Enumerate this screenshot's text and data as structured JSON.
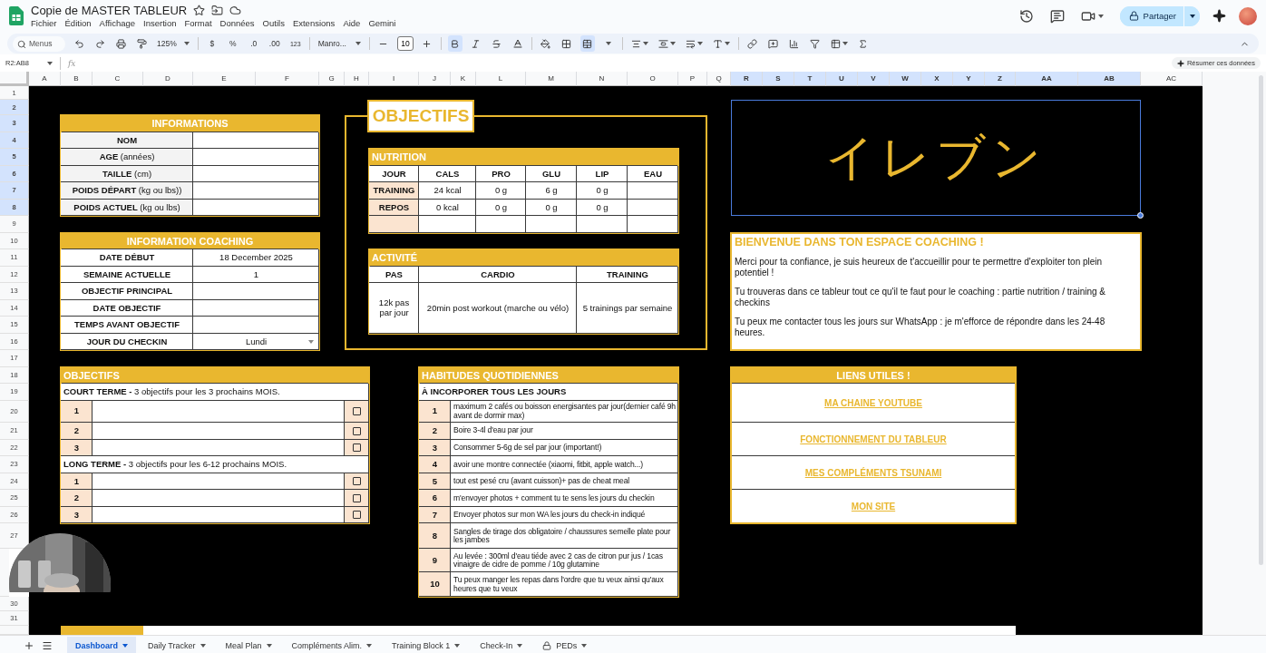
{
  "document": {
    "title": "Copie de MASTER TABLEUR"
  },
  "menu": [
    "Fichier",
    "Édition",
    "Affichage",
    "Insertion",
    "Format",
    "Données",
    "Outils",
    "Extensions",
    "Aide",
    "Gemini"
  ],
  "share_button": "Partager",
  "toolbar": {
    "search_placeholder": "Menus",
    "zoom": "125%",
    "currency": "$",
    "percent": "%",
    "decimals_less": ".0",
    "decimals_more": ".00",
    "number_format": "123",
    "font": "Manro...",
    "font_size": "10",
    "bold": true,
    "merge_cells": true
  },
  "name_box": "R2:AB8",
  "formula_label": "fx",
  "summarize_button": "Résumer ces données",
  "columns": [
    {
      "label": "A",
      "selected": false
    },
    {
      "label": "B",
      "selected": false
    },
    {
      "label": "C",
      "selected": false
    },
    {
      "label": "D",
      "selected": false
    },
    {
      "label": "E",
      "selected": false
    },
    {
      "label": "F",
      "selected": false
    },
    {
      "label": "G",
      "selected": false
    },
    {
      "label": "H",
      "selected": false
    },
    {
      "label": "I",
      "selected": false
    },
    {
      "label": "J",
      "selected": false
    },
    {
      "label": "K",
      "selected": false
    },
    {
      "label": "L",
      "selected": false
    },
    {
      "label": "M",
      "selected": false
    },
    {
      "label": "N",
      "selected": false
    },
    {
      "label": "O",
      "selected": false
    },
    {
      "label": "P",
      "selected": false
    },
    {
      "label": "Q",
      "selected": false
    },
    {
      "label": "R",
      "selected": true
    },
    {
      "label": "S",
      "selected": true
    },
    {
      "label": "T",
      "selected": true
    },
    {
      "label": "U",
      "selected": true
    },
    {
      "label": "V",
      "selected": true
    },
    {
      "label": "W",
      "selected": true
    },
    {
      "label": "X",
      "selected": true
    },
    {
      "label": "Y",
      "selected": true
    },
    {
      "label": "Z",
      "selected": true
    },
    {
      "label": "AA",
      "selected": true
    },
    {
      "label": "AB",
      "selected": true
    },
    {
      "label": "AC",
      "selected": false
    }
  ],
  "rows": [
    {
      "label": "1",
      "selected": false
    },
    {
      "label": "2",
      "selected": true
    },
    {
      "label": "3",
      "selected": true
    },
    {
      "label": "4",
      "selected": true
    },
    {
      "label": "5",
      "selected": true
    },
    {
      "label": "6",
      "selected": true
    },
    {
      "label": "7",
      "selected": true
    },
    {
      "label": "8",
      "selected": true
    },
    {
      "label": "9",
      "selected": false
    },
    {
      "label": "10",
      "selected": false
    },
    {
      "label": "11",
      "selected": false
    },
    {
      "label": "12",
      "selected": false
    },
    {
      "label": "13",
      "selected": false
    },
    {
      "label": "14",
      "selected": false
    },
    {
      "label": "15",
      "selected": false
    },
    {
      "label": "16",
      "selected": false
    },
    {
      "label": "17",
      "selected": false
    },
    {
      "label": "18",
      "selected": false
    },
    {
      "label": "19",
      "selected": false
    },
    {
      "label": "20",
      "selected": false
    },
    {
      "label": "21",
      "selected": false
    },
    {
      "label": "22",
      "selected": false
    },
    {
      "label": "23",
      "selected": false
    },
    {
      "label": "24",
      "selected": false
    },
    {
      "label": "25",
      "selected": false
    },
    {
      "label": "26",
      "selected": false
    },
    {
      "label": "27",
      "selected": false
    },
    {
      "label": "30",
      "selected": false,
      "after_gap": true
    },
    {
      "label": "31",
      "selected": false
    }
  ],
  "informations": {
    "title": "INFORMATIONS",
    "rows": [
      {
        "label": "NOM"
      },
      {
        "label": "AGE",
        "unit": "(années)"
      },
      {
        "label": "TAILLE",
        "unit": "(cm)"
      },
      {
        "label": "POIDS DÉPART",
        "unit": "(kg ou lbs))"
      },
      {
        "label": "POIDS ACTUEL",
        "unit": "(kg ou lbs)"
      }
    ]
  },
  "coaching": {
    "title": "INFORMATION COACHING",
    "rows": [
      {
        "label": "DATE DÉBUT",
        "kind": "text",
        "value": "18 December 2025"
      },
      {
        "label": "SEMAINE ACTUELLE",
        "kind": "text",
        "value": "1"
      },
      {
        "label": "OBJECTIF PRINCIPAL",
        "kind": "text"
      },
      {
        "label": "DATE OBJECTIF",
        "kind": "text"
      },
      {
        "label": "TEMPS AVANT OBJECTIF",
        "kind": "text"
      },
      {
        "label": "JOUR DU CHECKIN",
        "kind": "dropdown",
        "value": "Lundi"
      }
    ]
  },
  "objectifs_panel": {
    "title": "OBJECTIFS",
    "nutrition": {
      "title": "NUTRITION",
      "columns": [
        "JOUR",
        "CALS",
        "PRO",
        "GLU",
        "LIP",
        "EAU"
      ],
      "rows": [
        {
          "cells": [
            "TRAINING",
            "24 kcal",
            "0 g",
            "6 g",
            "0 g"
          ]
        },
        {
          "cells": [
            "REPOS",
            "0 kcal",
            "0 g",
            "0 g",
            "0 g"
          ]
        }
      ]
    },
    "activite": {
      "title": "ACTIVITÉ",
      "columns": [
        "PAS",
        "CARDIO",
        "TRAINING"
      ],
      "values": [
        "12k pas par jour",
        "20min post workout (marche ou vélo)",
        "5 trainings par semaine"
      ]
    }
  },
  "banner": {
    "text": "イレブン"
  },
  "welcome": {
    "title": "BIENVENUE DANS TON ESPACE COACHING !",
    "paragraphs": [
      "Merci pour ta confiance, je suis heureux de t'accueillir pour te permettre d'exploiter ton plein potentiel !",
      "Tu trouveras dans ce tableur tout ce qu'il te faut pour le coaching : partie nutrition / training & checkins",
      "Tu peux me contacter tous les jours sur WhatsApp : je m'efforce de répondre dans les 24-48 heures."
    ]
  },
  "links": {
    "title": "LIENS UTILES !",
    "items": [
      "MA CHAINE YOUTUBE",
      "FONCTIONNEMENT DU TABLEUR",
      "MES COMPLÉMENTS TSUNAMI",
      "MON SITE"
    ]
  },
  "goals": {
    "title": "OBJECTIFS",
    "sections": [
      {
        "term": "COURT TERME -",
        "description": "3 objectifs pour les 3 prochains MOIS.",
        "items": [
          {
            "number": "1",
            "checked": false
          },
          {
            "number": "2",
            "checked": false
          },
          {
            "number": "3",
            "checked": false
          }
        ]
      },
      {
        "term": "LONG TERME -",
        "description": "3 objectifs pour les 6-12 prochains MOIS.",
        "items": [
          {
            "number": "1",
            "checked": false
          },
          {
            "number": "2",
            "checked": false
          },
          {
            "number": "3",
            "checked": false
          }
        ]
      }
    ]
  },
  "habits": {
    "title": "HABITUDES QUOTIDIENNES",
    "subtitle": "À INCORPORER TOUS LES JOURS",
    "items": [
      {
        "number": "1",
        "text": "maximum 2 cafés ou boisson energisantes par jour(dernier café 9h avant de dormir max)"
      },
      {
        "number": "2",
        "text": "Boire 3-4l d'eau par jour"
      },
      {
        "number": "3",
        "text": "Consommer 5-6g de sel par jour (important!)"
      },
      {
        "number": "4",
        "text": "avoir une montre connectée (xiaomi, fitbit, apple watch...)"
      },
      {
        "number": "5",
        "text": "tout est pesé cru (avant cuisson)+ pas de cheat meal"
      },
      {
        "number": "6",
        "text": "m'envoyer photos + comment tu te sens les jours du checkin"
      },
      {
        "number": "7",
        "text": "Envoyer photos sur mon WA les jours du check-in indiqué"
      },
      {
        "number": "8",
        "text": "Sangles de tirage dos obligatoire / chaussures semelle plate pour les jambes"
      },
      {
        "number": "9",
        "text": "Au levée : 300ml d'eau tiéde avec 2 cas de citron pur jus / 1cas vinaigre de cidre de pomme / 10g glutamine"
      },
      {
        "number": "10",
        "text": "Tu peux manger les repas dans l'ordre que tu veux ainsi qu'aux heures que tu veux"
      }
    ]
  },
  "sheet_tabs": [
    {
      "label": "Dashboard",
      "selected": true,
      "locked": false
    },
    {
      "label": "Daily Tracker",
      "selected": false,
      "locked": false
    },
    {
      "label": "Meal Plan",
      "selected": false,
      "locked": false
    },
    {
      "label": "Compléments Alim.",
      "selected": false,
      "locked": false
    },
    {
      "label": "Training Block 1",
      "selected": false,
      "locked": false
    },
    {
      "label": "Check-In",
      "selected": false,
      "locked": false
    },
    {
      "label": "PEDs",
      "selected": false,
      "locked": true
    }
  ]
}
